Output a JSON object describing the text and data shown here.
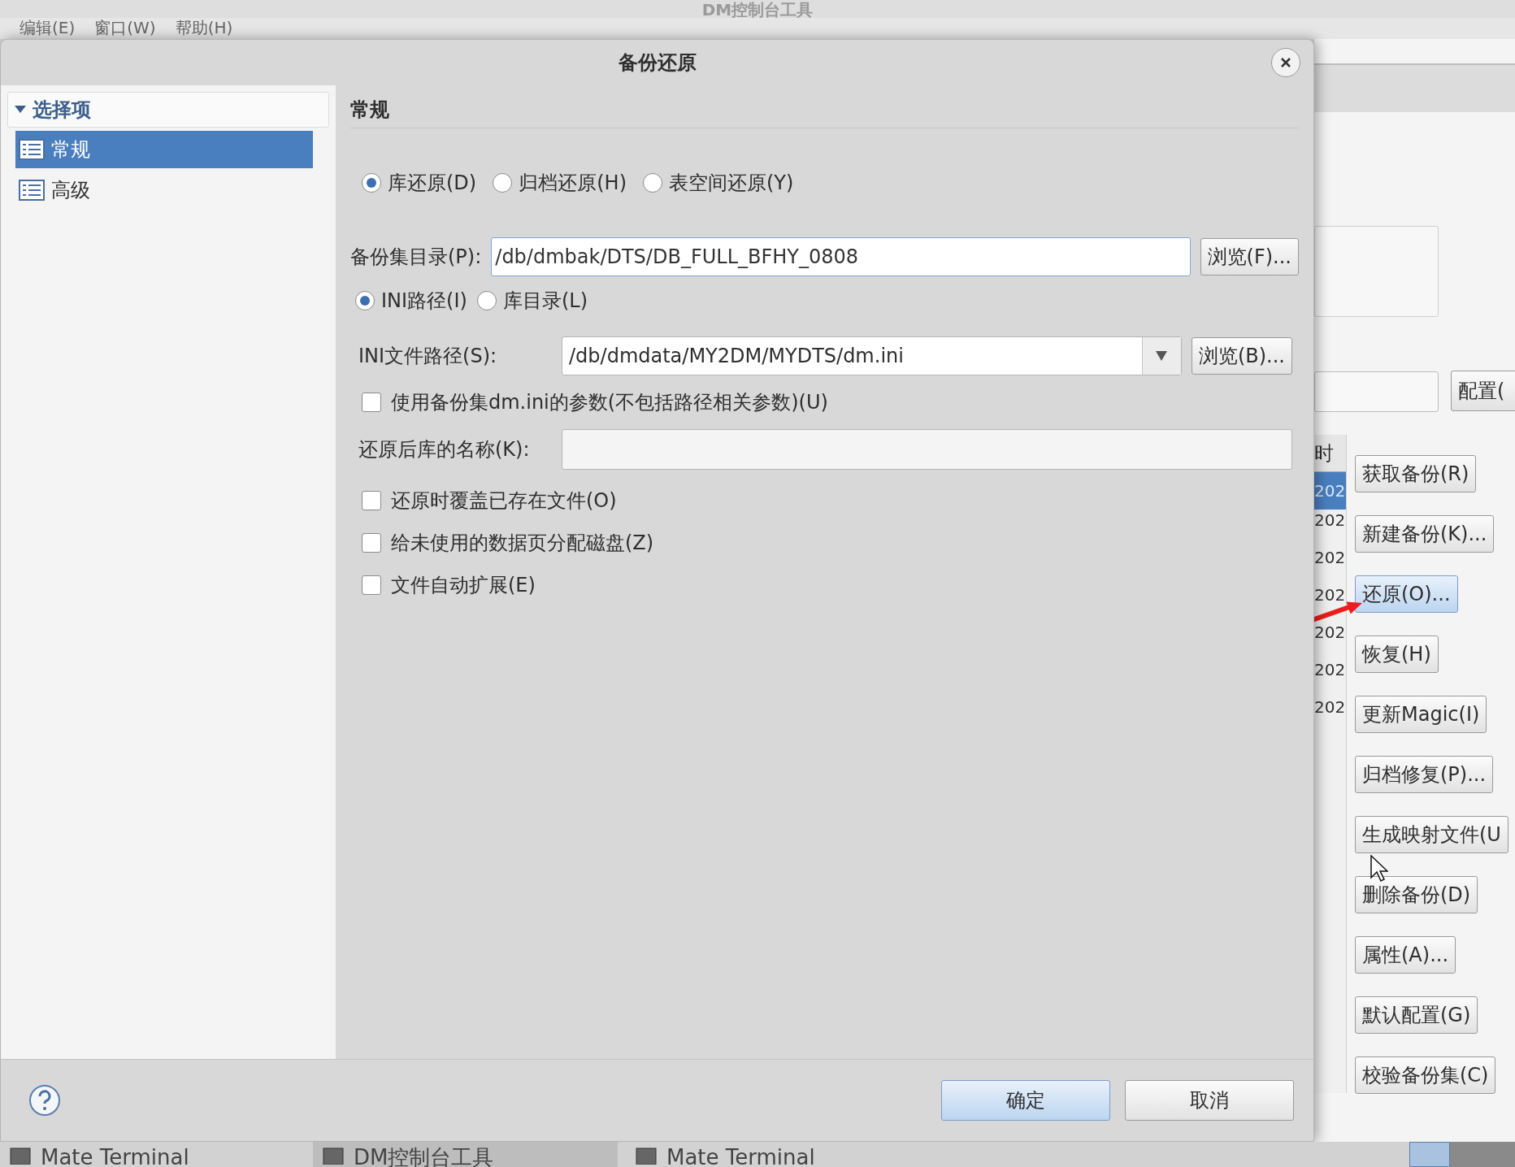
{
  "background_window": {
    "title": "DM控制台工具",
    "menu": [
      "编辑(E)",
      "窗口(W)",
      "帮助(H)"
    ],
    "config_button": "配置(",
    "table": {
      "column_header": "时",
      "rows": [
        {
          "text": "202",
          "selected": true
        },
        {
          "text": "202",
          "selected": false
        },
        {
          "text": "202",
          "selected": false
        },
        {
          "text": "202",
          "selected": false
        },
        {
          "text": "202",
          "selected": false
        },
        {
          "text": "202",
          "selected": false
        },
        {
          "text": "202",
          "selected": false
        }
      ]
    },
    "side_buttons": [
      {
        "label": "获取备份(R)",
        "selected": false
      },
      {
        "label": "新建备份(K)...",
        "selected": false
      },
      {
        "label": "还原(O)...",
        "selected": true
      },
      {
        "label": "恢复(H)",
        "selected": false
      },
      {
        "label": "更新Magic(I)",
        "selected": false
      },
      {
        "label": "归档修复(P)...",
        "selected": false
      },
      {
        "label": "生成映射文件(U",
        "selected": false
      },
      {
        "label": "删除备份(D)",
        "selected": false
      },
      {
        "label": "属性(A)...",
        "selected": false
      },
      {
        "label": "默认配置(G)",
        "selected": false
      },
      {
        "label": "校验备份集(C)",
        "selected": false
      }
    ]
  },
  "dialog": {
    "title": "备份还原",
    "sidebar": {
      "header": "选择项",
      "expanded": true,
      "items": [
        {
          "label": "常规",
          "selected": true
        },
        {
          "label": "高级",
          "selected": false
        }
      ]
    },
    "section_title": "常规",
    "restore_types": [
      {
        "label": "库还原(D)",
        "selected": true
      },
      {
        "label": "归档还原(H)",
        "selected": false
      },
      {
        "label": "表空间还原(Y)",
        "selected": false
      }
    ],
    "backup_dir": {
      "label": "备份集目录(P):",
      "value": "/db/dmbak/DTS/DB_FULL_BFHY_0808",
      "button": "浏览(F)..."
    },
    "ini_modes": [
      {
        "label": "INI路径(I)",
        "selected": true
      },
      {
        "label": "库目录(L)",
        "selected": false
      }
    ],
    "ini_path": {
      "label": "INI文件路径(S):",
      "value": "/db/dmdata/MY2DM/MYDTS/dm.ini",
      "button": "浏览(B)..."
    },
    "ini_params_option": {
      "label": "使用备份集dm.ini的参数(不包括路径相关参数)(U)",
      "checked": false
    },
    "db_name": {
      "label": "还原后库的名称(K):"
    },
    "options": [
      {
        "label": "还原时覆盖已存在文件(O)",
        "checked": false
      },
      {
        "label": "给未使用的数据页分配磁盘(Z)",
        "checked": false
      },
      {
        "label": "文件自动扩展(E)",
        "checked": false
      }
    ],
    "ok_button": "确定",
    "cancel_button": "取消"
  },
  "taskbar": [
    {
      "label": "Mate Terminal",
      "selected": false
    },
    {
      "label": "DM控制台工具",
      "selected": true
    },
    {
      "label": "Mate Terminal",
      "selected": false
    }
  ]
}
